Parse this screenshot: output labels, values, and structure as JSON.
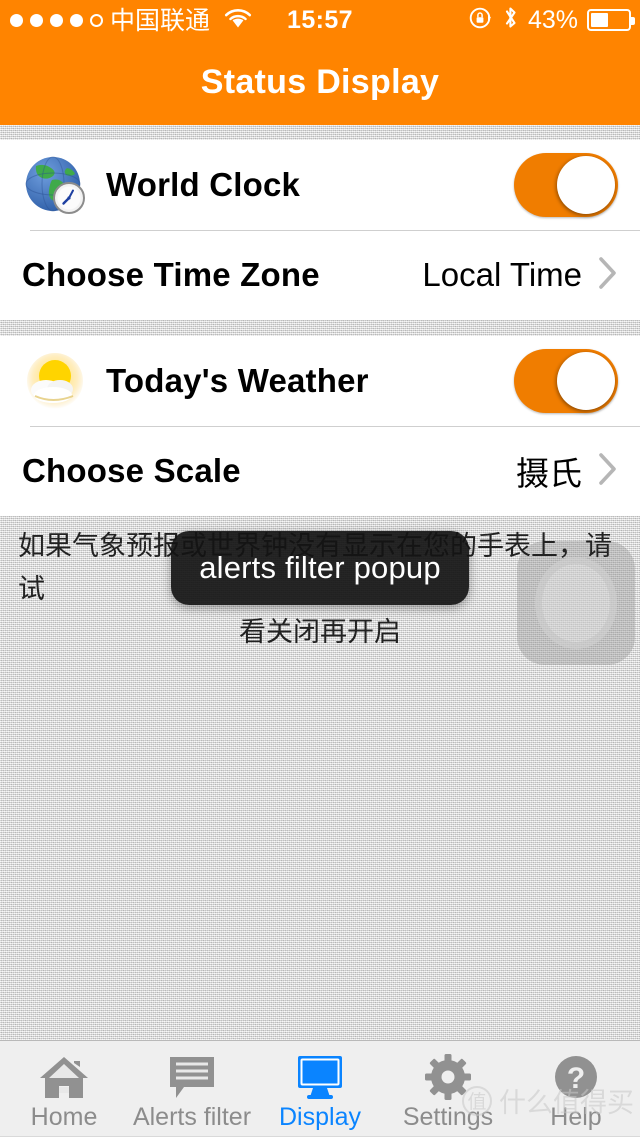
{
  "status_bar": {
    "signal_dots_filled": 4,
    "signal_dots_total": 5,
    "carrier": "中国联通",
    "wifi_icon": "wifi-icon",
    "time": "15:57",
    "rotation_lock_icon": "rotation-lock-icon",
    "bluetooth_icon": "bluetooth-icon",
    "battery_percent": "43%",
    "battery_level": 43,
    "bar_color": "#FF8400"
  },
  "navbar": {
    "title": "Status Display",
    "background": "#FF8400",
    "text_color": "#FFFFFF"
  },
  "sections": [
    {
      "rows": [
        {
          "type": "toggle",
          "icon": "globe-clock-icon",
          "title": "World Clock",
          "toggle_on": true,
          "toggle_color": "#F07D00"
        },
        {
          "type": "disclosure",
          "title": "Choose Time Zone",
          "value": "Local Time",
          "chevron": "chevron-right-icon"
        }
      ]
    },
    {
      "rows": [
        {
          "type": "toggle",
          "icon": "sun-cloud-icon",
          "title": "Today's Weather",
          "toggle_on": true,
          "toggle_color": "#F07D00"
        },
        {
          "type": "disclosure",
          "title": "Choose Scale",
          "value": "摄氏",
          "chevron": "chevron-right-icon"
        }
      ]
    }
  ],
  "hint": {
    "line1": "如果气象预报或世界钟没有显示在您的手表上，请试",
    "line2": "看关闭再开启"
  },
  "watermark_watch": {
    "icon": "watch-face-watermark-icon"
  },
  "toast": {
    "text": "alerts filter popup",
    "background": "#141414",
    "text_color": "#FFFFFF"
  },
  "tabbar": {
    "active_color": "#0A84FF",
    "inactive_color": "#8C8C8C",
    "items": [
      {
        "label": "Home",
        "icon": "home-icon",
        "active": false
      },
      {
        "label": "Alerts filter",
        "icon": "speech-bubble-icon",
        "active": false
      },
      {
        "label": "Display",
        "icon": "monitor-icon",
        "active": true
      },
      {
        "label": "Settings",
        "icon": "gear-icon",
        "active": false
      },
      {
        "label": "Help",
        "icon": "question-mark-icon",
        "active": false
      }
    ]
  },
  "brand_watermark": {
    "badge": "值",
    "text": "什么值得买"
  }
}
